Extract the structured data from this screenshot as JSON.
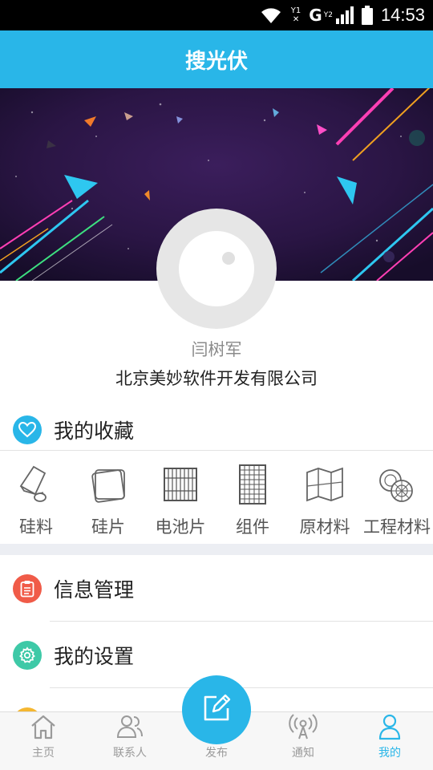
{
  "status_bar": {
    "time": "14:53",
    "sim1_label": "Y1",
    "sim2_label": "Y2",
    "network_label": "G",
    "icons": [
      "wifi-icon",
      "sim1-icon",
      "signal-icon",
      "battery-icon"
    ]
  },
  "header": {
    "title": "搜光伏"
  },
  "profile": {
    "name": "闫树军",
    "company": "北京美妙软件开发有限公司"
  },
  "favorites": {
    "title": "我的收藏",
    "icon": "heart-icon",
    "accent": "#29b6e8",
    "categories": [
      {
        "label": "硅料",
        "icon": "silicon-material-icon"
      },
      {
        "label": "硅片",
        "icon": "wafer-icon"
      },
      {
        "label": "电池片",
        "icon": "cell-icon"
      },
      {
        "label": "组件",
        "icon": "module-icon"
      },
      {
        "label": "原材料",
        "icon": "raw-material-icon"
      },
      {
        "label": "工程材料",
        "icon": "engineering-material-icon"
      }
    ]
  },
  "menu": [
    {
      "label": "信息管理",
      "icon": "clipboard-icon",
      "color": "#f05b48"
    },
    {
      "label": "我的设置",
      "icon": "gear-icon",
      "color": "#3ec9a7"
    },
    {
      "label": "",
      "icon": "partial-icon",
      "color": "#f5b731"
    }
  ],
  "tabbar": {
    "tabs": [
      {
        "label": "主页",
        "icon": "home-icon",
        "active": false
      },
      {
        "label": "联系人",
        "icon": "contacts-icon",
        "active": false
      },
      {
        "label": "发布",
        "icon": "edit-icon",
        "active": false
      },
      {
        "label": "通知",
        "icon": "broadcast-icon",
        "active": false
      },
      {
        "label": "我的",
        "icon": "user-icon",
        "active": true
      }
    ],
    "active_color": "#29b6e8",
    "inactive_color": "#9a9a9a"
  }
}
